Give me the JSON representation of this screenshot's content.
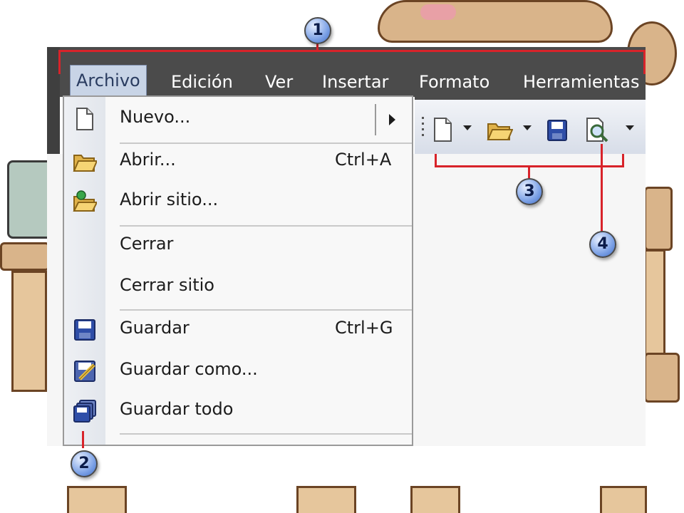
{
  "menubar": {
    "items": [
      {
        "label": "Archivo",
        "active": true
      },
      {
        "label": "Edición"
      },
      {
        "label": "Ver"
      },
      {
        "label": "Insertar"
      },
      {
        "label": "Formato"
      },
      {
        "label": "Herramientas"
      }
    ]
  },
  "file_menu": {
    "items": [
      {
        "label": "Nuevo...",
        "shortcut": "",
        "icon": "new-document-icon",
        "has_submenu": true
      },
      {
        "label": "Abrir...",
        "shortcut": "Ctrl+A",
        "icon": "open-folder-icon"
      },
      {
        "label": "Abrir sitio...",
        "shortcut": "",
        "icon": "open-site-icon"
      },
      {
        "label": "Cerrar",
        "shortcut": "",
        "icon": ""
      },
      {
        "label": "Cerrar sitio",
        "shortcut": "",
        "icon": ""
      },
      {
        "label": "Guardar",
        "shortcut": "Ctrl+G",
        "icon": "save-icon"
      },
      {
        "label": "Guardar como...",
        "shortcut": "",
        "icon": "save-as-icon"
      },
      {
        "label": "Guardar todo",
        "shortcut": "",
        "icon": "save-all-icon"
      }
    ]
  },
  "toolbar": {
    "buttons": [
      "new-document-icon",
      "open-folder-icon",
      "save-icon",
      "preview-icon"
    ]
  },
  "callouts": [
    "1",
    "2",
    "3",
    "4"
  ],
  "colors": {
    "callout_line": "#d8232a",
    "menubar_bg": "#4b4b4b",
    "menu_highlight": "#c8d4e6"
  }
}
